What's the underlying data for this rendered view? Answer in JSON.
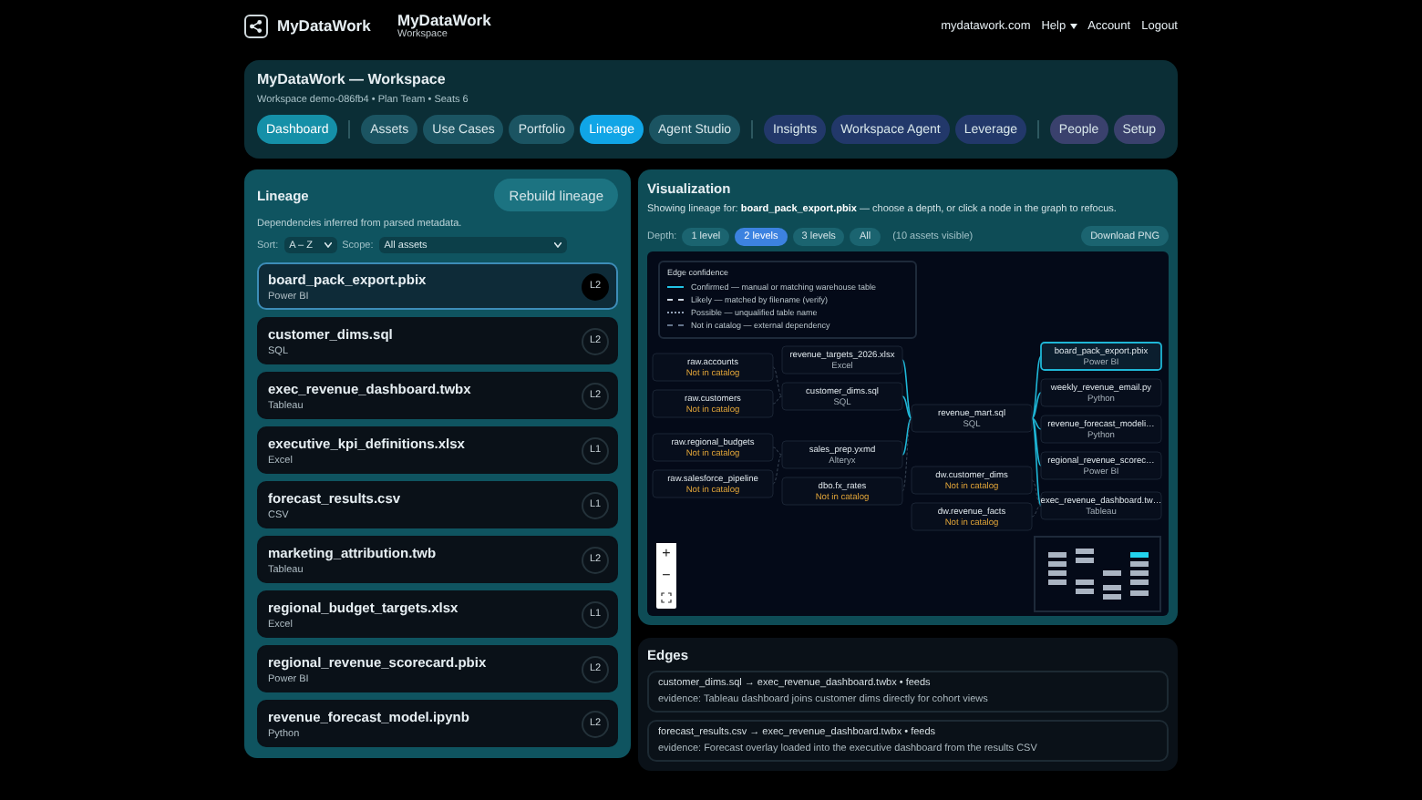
{
  "brand": {
    "name": "MyDataWork"
  },
  "workspace_label": {
    "title": "MyDataWork",
    "subtitle": "Workspace"
  },
  "top_links": [
    {
      "label": "mydatawork.com",
      "caret": false
    },
    {
      "label": "Help",
      "caret": true
    },
    {
      "label": "Account",
      "caret": false
    },
    {
      "label": "Logout",
      "caret": false
    }
  ],
  "nav": {
    "title": "MyDataWork — Workspace",
    "meta": "Workspace demo-086fb4 • Plan Team • Seats 6",
    "tabs": [
      {
        "label": "Dashboard",
        "kind": "home",
        "selected": false
      },
      {
        "label": "Assets",
        "kind": "build",
        "selected": false
      },
      {
        "label": "Use Cases",
        "kind": "build",
        "selected": false
      },
      {
        "label": "Portfolio",
        "kind": "build",
        "selected": false
      },
      {
        "label": "Lineage",
        "kind": "build",
        "selected": true
      },
      {
        "label": "Agent Studio",
        "kind": "build",
        "selected": false
      },
      {
        "label": "Insights",
        "kind": "insight",
        "selected": false
      },
      {
        "label": "Workspace Agent",
        "kind": "insight",
        "selected": false
      },
      {
        "label": "Leverage",
        "kind": "insight",
        "selected": false
      },
      {
        "label": "People",
        "kind": "admin",
        "selected": false
      },
      {
        "label": "Setup",
        "kind": "admin",
        "selected": false
      }
    ]
  },
  "lineage": {
    "title": "Lineage",
    "rebuild_button": "Rebuild lineage",
    "description": "Dependencies inferred from parsed metadata.",
    "sort": {
      "label": "Sort:",
      "value": "A – Z"
    },
    "scope": {
      "label": "Scope:",
      "value": "All assets"
    },
    "assets": [
      {
        "name": "board_pack_export.pbix",
        "type": "Power BI",
        "badge": "L2",
        "selected": true
      },
      {
        "name": "customer_dims.sql",
        "type": "SQL",
        "badge": "L2",
        "selected": false
      },
      {
        "name": "exec_revenue_dashboard.twbx",
        "type": "Tableau",
        "badge": "L2",
        "selected": false
      },
      {
        "name": "executive_kpi_definitions.xlsx",
        "type": "Excel",
        "badge": "L1",
        "selected": false
      },
      {
        "name": "forecast_results.csv",
        "type": "CSV",
        "badge": "L1",
        "selected": false
      },
      {
        "name": "marketing_attribution.twb",
        "type": "Tableau",
        "badge": "L2",
        "selected": false
      },
      {
        "name": "regional_budget_targets.xlsx",
        "type": "Excel",
        "badge": "L1",
        "selected": false
      },
      {
        "name": "regional_revenue_scorecard.pbix",
        "type": "Power BI",
        "badge": "L2",
        "selected": false
      },
      {
        "name": "revenue_forecast_model.ipynb",
        "type": "Python",
        "badge": "L2",
        "selected": false
      }
    ]
  },
  "visualization": {
    "title": "Visualization",
    "intro": "Showing lineage for: **board_pack_export.pbix** — choose a depth, or click a node in the graph to refocus.",
    "depth_label": "Depth:",
    "depths": [
      {
        "label": "1 level",
        "selected": false
      },
      {
        "label": "2 levels",
        "selected": true
      },
      {
        "label": "3 levels",
        "selected": false
      },
      {
        "label": "All",
        "selected": false
      }
    ],
    "visible_count": "(10 assets visible)",
    "download_button": "Download PNG",
    "legend": {
      "title": "Edge confidence",
      "items": [
        {
          "kind": "confirmed",
          "label": "Confirmed — manual or matching warehouse table"
        },
        {
          "kind": "likely",
          "label": "Likely — matched by filename (verify)"
        },
        {
          "kind": "possible",
          "label": "Possible — unqualified table name"
        },
        {
          "kind": "external",
          "label": "Not in catalog — external dependency"
        }
      ]
    },
    "zoom_controls": {
      "zoom_in": "+",
      "zoom_out": "−"
    },
    "graph_columns": [
      [
        {
          "name": "raw.accounts",
          "type": "Not in catalog",
          "external": true,
          "focus": false
        },
        {
          "name": "raw.customers",
          "type": "Not in catalog",
          "external": true,
          "focus": false
        },
        {
          "name": "raw.regional_budgets",
          "type": "Not in catalog",
          "external": true,
          "focus": false
        },
        {
          "name": "raw.salesforce_pipeline",
          "type": "Not in catalog",
          "external": true,
          "focus": false
        }
      ],
      [
        {
          "name": "revenue_targets_2026.xlsx",
          "type": "Excel",
          "external": false,
          "focus": false
        },
        {
          "name": "customer_dims.sql",
          "type": "SQL",
          "external": false,
          "focus": false
        },
        {
          "name": "sales_prep.yxmd",
          "type": "Alteryx",
          "external": false,
          "focus": false
        },
        {
          "name": "dbo.fx_rates",
          "type": "Not in catalog",
          "external": true,
          "focus": false
        }
      ],
      [
        {
          "name": "revenue_mart.sql",
          "type": "SQL",
          "external": false,
          "focus": false
        },
        {
          "name": "dw.customer_dims",
          "type": "Not in catalog",
          "external": true,
          "focus": false
        },
        {
          "name": "dw.revenue_facts",
          "type": "Not in catalog",
          "external": true,
          "focus": false
        }
      ],
      [
        {
          "name": "board_pack_export.pbix",
          "type": "Power BI",
          "external": false,
          "focus": true
        },
        {
          "name": "weekly_revenue_email.py",
          "type": "Python",
          "external": false,
          "focus": false
        },
        {
          "name": "revenue_forecast_modeli…",
          "type": "Python",
          "external": false,
          "focus": false
        },
        {
          "name": "regional_revenue_scorec…",
          "type": "Power BI",
          "external": false,
          "focus": false
        },
        {
          "name": "exec_revenue_dashboard.tw…",
          "type": "Tableau",
          "external": false,
          "focus": false
        }
      ]
    ]
  },
  "edges": {
    "title": "Edges",
    "items": [
      {
        "text": "customer_dims.sql → exec_revenue_dashboard.twbx • feeds",
        "evidence": "evidence: Tableau dashboard joins customer dims directly for cohort views"
      },
      {
        "text": "forecast_results.csv → exec_revenue_dashboard.twbx • feeds",
        "evidence": "evidence: Forecast overlay loaded into the executive dashboard from the results CSV"
      }
    ]
  }
}
